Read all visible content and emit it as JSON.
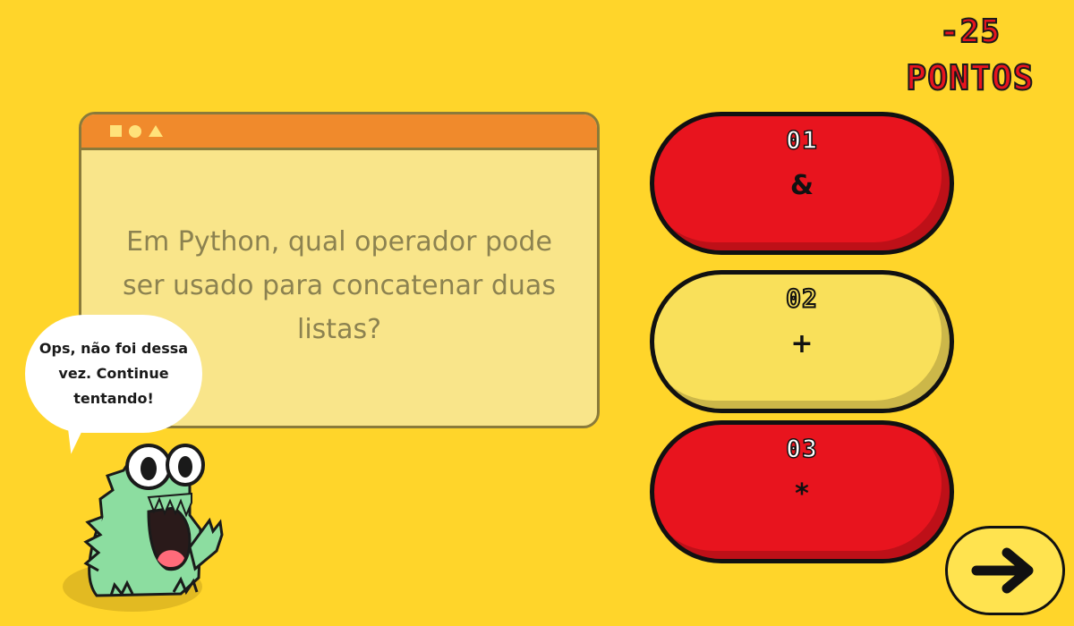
{
  "score": {
    "value": "-25",
    "label": "PONTOS"
  },
  "question": {
    "text": "Em Python, qual operador pode ser usado para concatenar duas listas?",
    "window_icons": [
      "square-icon",
      "circle-icon",
      "triangle-icon"
    ]
  },
  "answers": [
    {
      "number": "01",
      "symbol": "&",
      "state": "wrong"
    },
    {
      "number": "02",
      "symbol": "+",
      "state": "neutral"
    },
    {
      "number": "03",
      "symbol": "*",
      "state": "wrong"
    }
  ],
  "feedback": {
    "message": "Ops, não foi dessa vez. Continue tentando!"
  },
  "next_button": {
    "icon": "arrow-right-icon"
  },
  "colors": {
    "background": "#FFD52A",
    "wrong_answer": "#E8141E",
    "neutral_answer": "#F9E05A",
    "window_bar": "#F08A2C",
    "window_body": "#F9E58A",
    "monster": "#8CDDA0"
  }
}
